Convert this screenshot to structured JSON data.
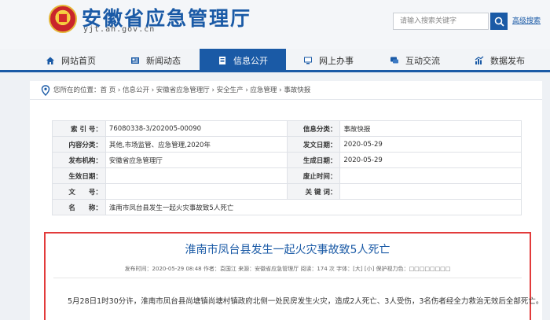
{
  "header": {
    "site_title": "安徽省应急管理厅",
    "site_domain": "yjt.ah.gov.cn",
    "search_placeholder": "请输入搜索关键字",
    "advanced_search": "高级搜索"
  },
  "nav": {
    "items": [
      {
        "label": "网站首页",
        "icon": "home-icon"
      },
      {
        "label": "新闻动态",
        "icon": "newspaper-icon"
      },
      {
        "label": "信息公开",
        "icon": "document-icon"
      },
      {
        "label": "网上办事",
        "icon": "monitor-icon"
      },
      {
        "label": "互动交流",
        "icon": "chat-icon"
      },
      {
        "label": "数据发布",
        "icon": "chart-icon"
      }
    ],
    "active_label": "信息公开"
  },
  "breadcrumb": {
    "text": "您所在的位置：首 页 › 信息公开 › 安徽省应急管理厅 › 安全生产 › 应急管理 › 事故快报"
  },
  "meta": {
    "index_label": "索 引 号：",
    "index_value": "76080338-3/202005-00090",
    "category_label": "信息分类：",
    "category_value": "事故快报",
    "content_label": "内容分类：",
    "content_value": "其他,市场监管、应急管理,2020年",
    "pubdate_label": "发文日期：",
    "pubdate_value": "2020-05-29",
    "org_label": "发布机构：",
    "org_value": "安徽省应急管理厅",
    "gendate_label": "生成日期：",
    "gendate_value": "2020-05-29",
    "effect_label": "生效日期：",
    "effect_value": "",
    "expire_label": "废止时间：",
    "expire_value": "",
    "docno_label": "文　　号：",
    "docno_value": "",
    "keyword_label": "关 键 词：",
    "keyword_value": "",
    "name_label": "名　　称：",
    "name_value": "淮南市凤台县发生一起火灾事故致5人死亡"
  },
  "article": {
    "title": "淮南市凤台县发生一起火灾事故致5人死亡",
    "info": "发布时间：2020-05-29 08:48   作者：袁国江   来源：安徽省应急管理厅   阅读：174 次   字体：[大] [小]   保护视力色：□□□□□□□□",
    "body": "5月28日1时30分许，淮南市凤台县尚塘镇尚塘村镇政府北侧一处民房发生火灾，造成2人死亡、3人受伤，3名伤者经全力救治无效后全部死亡。"
  },
  "colors": {
    "brand_blue": "#1a5aa6",
    "highlight_red": "#e23b3b"
  }
}
